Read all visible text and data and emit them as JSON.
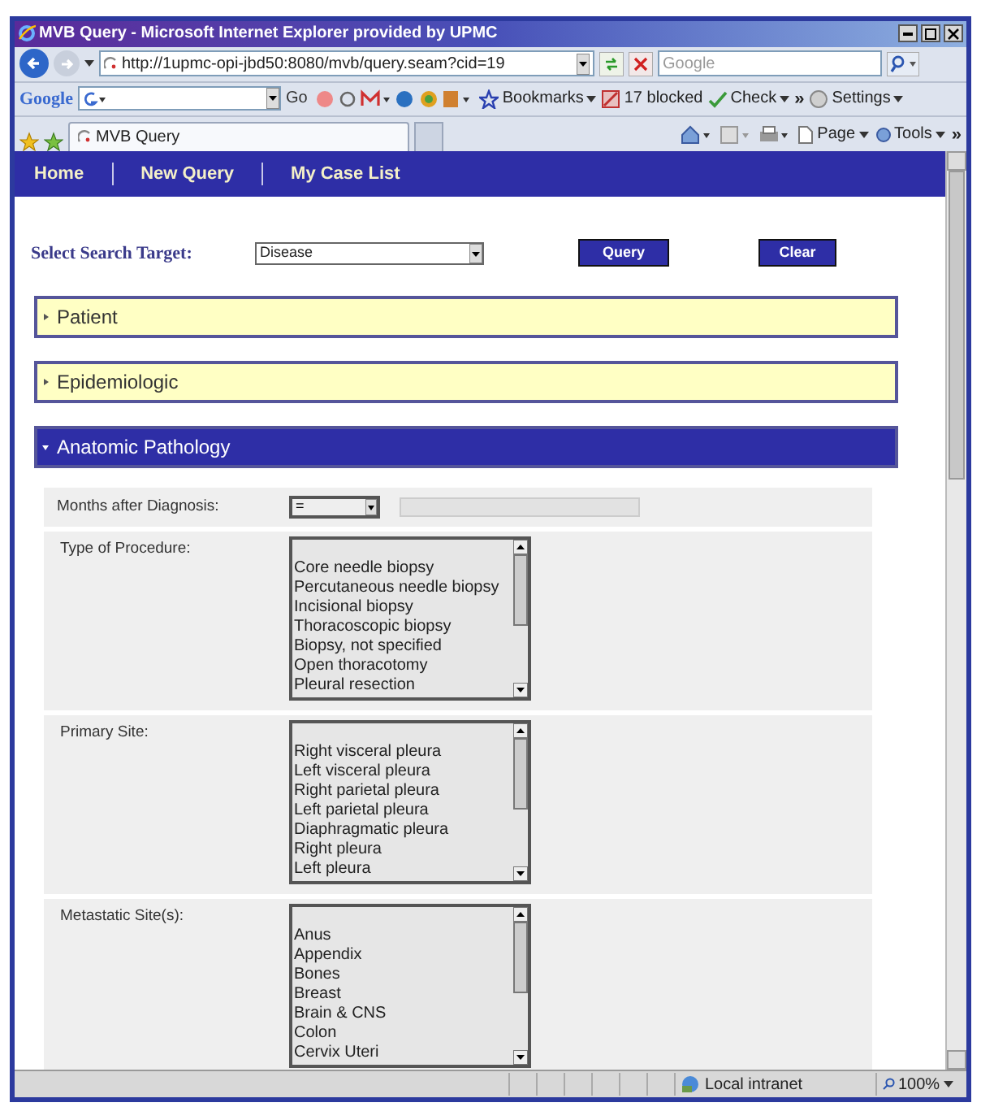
{
  "window": {
    "title": "MVB Query - Microsoft Internet Explorer provided by UPMC"
  },
  "address_bar": {
    "url": "http://1upmc-opi-jbd50:8080/mvb/query.seam?cid=19",
    "search_placeholder": "Google"
  },
  "google_toolbar": {
    "search_brand": "Google",
    "go": "Go",
    "items": [
      {
        "kind": "bookmarks",
        "label": "Bookmarks"
      },
      {
        "kind": "blocked",
        "label": "17 blocked"
      },
      {
        "kind": "check",
        "label": "Check"
      },
      {
        "kind": "more",
        "label": "»"
      },
      {
        "kind": "settings",
        "label": "Settings"
      }
    ]
  },
  "tabs": [
    {
      "label": "MVB Query",
      "selected": true
    }
  ],
  "command_bar": [
    {
      "kind": "page",
      "label": "Page"
    },
    {
      "kind": "tools",
      "label": "Tools"
    }
  ],
  "overflow_mark": "»",
  "nav": [
    {
      "label": "Home"
    },
    {
      "label": "New Query"
    },
    {
      "label": "My Case List"
    }
  ],
  "search_target": {
    "label": "Select Search Target:",
    "value": "Disease"
  },
  "buttons": [
    {
      "label": "Query"
    },
    {
      "label": "Clear"
    }
  ],
  "sections": [
    {
      "title": "Patient",
      "expanded": false
    },
    {
      "title": "Epidemiologic",
      "expanded": false
    },
    {
      "title": "Anatomic Pathology",
      "expanded": true
    }
  ],
  "fields": [
    {
      "kind": "comparison",
      "label": "Months after Diagnosis:",
      "operator": "="
    },
    {
      "kind": "listbox",
      "label": "Type of Procedure:",
      "options": [
        "Core needle biopsy",
        "Percutaneous needle biopsy",
        "Incisional biopsy",
        "Thoracoscopic biopsy",
        "Biopsy, not specified",
        "Open thoracotomy",
        "Pleural resection"
      ]
    },
    {
      "kind": "listbox",
      "label": "Primary Site:",
      "options": [
        "Right visceral pleura",
        "Left visceral pleura",
        "Right parietal pleura",
        "Left parietal pleura",
        "Diaphragmatic pleura",
        "Right pleura",
        "Left pleura"
      ]
    },
    {
      "kind": "listbox",
      "label": "Metastatic Site(s):",
      "options": [
        "Anus",
        "Appendix",
        "Bones",
        "Breast",
        "Brain & CNS",
        "Colon",
        "Cervix Uteri"
      ]
    }
  ],
  "status_bar": {
    "zone": "Local intranet",
    "zoom": "100%"
  }
}
